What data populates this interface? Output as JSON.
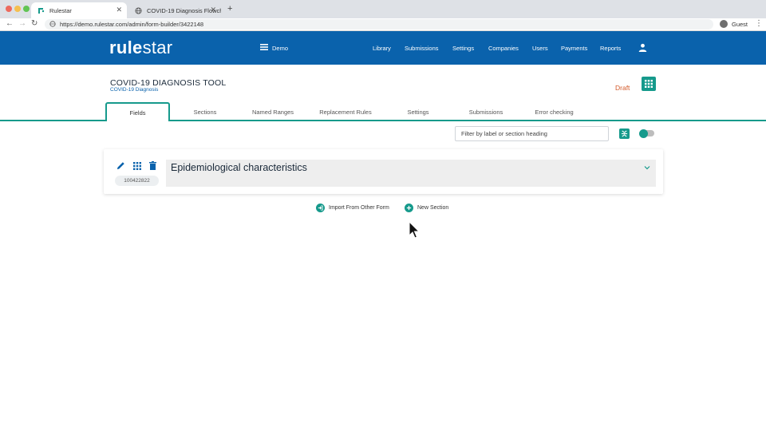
{
  "browser": {
    "tabs": [
      {
        "title": "Rulestar",
        "active": true
      },
      {
        "title": "COVID-19 Diagnosis Flowchart",
        "active": false
      }
    ],
    "url": "https://demo.rulestar.com/admin/form-builder/3422148",
    "profile": "Guest"
  },
  "app": {
    "logo_bold": "rule",
    "logo_light": "star",
    "org_name": "Demo",
    "nav": [
      "Library",
      "Submissions",
      "Settings",
      "Companies",
      "Users",
      "Payments",
      "Reports"
    ],
    "brand_color": "#0a62ac",
    "accent_color": "#169a8c"
  },
  "page": {
    "title": "COVID-19 DIAGNOSIS TOOL",
    "subtitle": "COVID-19 Diagnosis",
    "status": "Draft"
  },
  "tabs": [
    "Fields",
    "Sections",
    "Named Ranges",
    "Replacement Rules",
    "Settings",
    "Submissions",
    "Error checking"
  ],
  "active_tab": "Fields",
  "filter": {
    "placeholder": "Filter by label or section heading"
  },
  "section": {
    "heading": "Epidemiological characteristics",
    "id": "100422822"
  },
  "actions": {
    "import_label": "Import From Other Form",
    "new_section_label": "New Section"
  }
}
